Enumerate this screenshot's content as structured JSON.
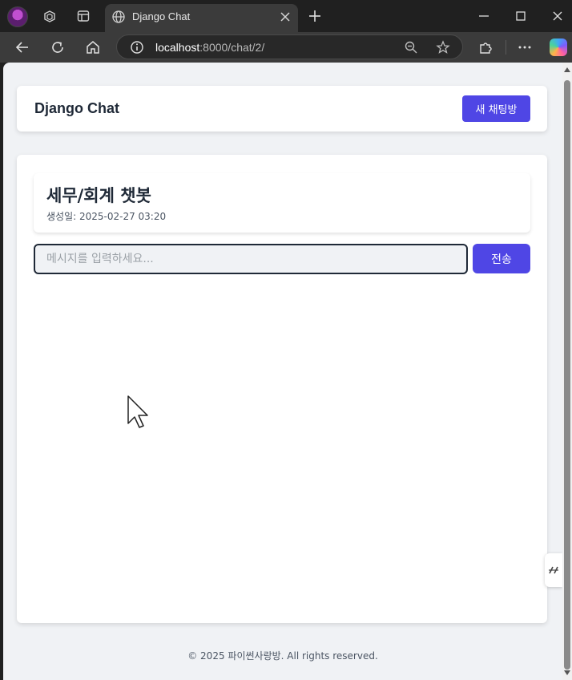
{
  "browser": {
    "tab_title": "Django Chat",
    "url_host": "localhost",
    "url_rest": ":8000/chat/2/"
  },
  "header": {
    "brand": "Django Chat",
    "new_room_label": "새 채팅방"
  },
  "room": {
    "title": "세무/회계 챗봇",
    "created_at": "생성일: 2025-02-27 03:20"
  },
  "composer": {
    "placeholder": "메시지를 입력하세요...",
    "value": "",
    "send_label": "전송"
  },
  "footer": {
    "text": "© 2025 파이썬사랑방. All rights reserved."
  },
  "colors": {
    "accent": "#4f46e5",
    "page_bg": "#f0f2f5"
  }
}
